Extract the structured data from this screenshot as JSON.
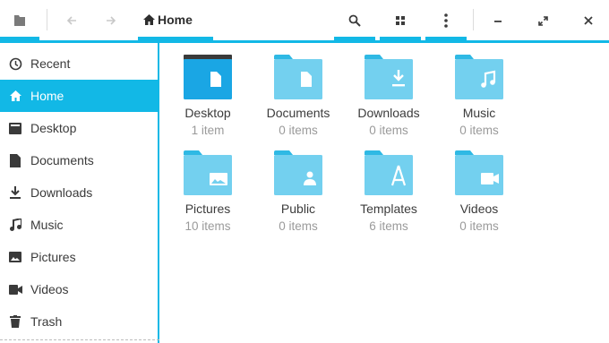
{
  "colors": {
    "accent": "#12b8e6",
    "folder": "#73d0ef",
    "folder_tab": "#2fb9e4",
    "desktop_folder": "#1aa6e4",
    "desktop_tab": "#3a3a3a"
  },
  "header": {
    "breadcrumb": {
      "icon": "home-icon",
      "label": "Home"
    },
    "buttons": [
      "file-manager-icon",
      "back-arrow-icon",
      "forward-arrow-icon",
      "search-icon",
      "grid-view-icon",
      "more-vertical-icon",
      "minimize-icon",
      "maximize-icon",
      "close-icon"
    ]
  },
  "sidebar": {
    "items": [
      {
        "label": "Recent",
        "icon": "clock-icon"
      },
      {
        "label": "Home",
        "icon": "home-icon",
        "active": true
      },
      {
        "label": "Desktop",
        "icon": "desktop-icon"
      },
      {
        "label": "Documents",
        "icon": "document-icon"
      },
      {
        "label": "Downloads",
        "icon": "download-icon"
      },
      {
        "label": "Music",
        "icon": "music-icon"
      },
      {
        "label": "Pictures",
        "icon": "picture-icon"
      },
      {
        "label": "Videos",
        "icon": "video-icon"
      },
      {
        "label": "Trash",
        "icon": "trash-icon"
      }
    ]
  },
  "folders": [
    {
      "name": "Desktop",
      "count": "1 item"
    },
    {
      "name": "Documents",
      "count": "0 items"
    },
    {
      "name": "Downloads",
      "count": "0 items"
    },
    {
      "name": "Music",
      "count": "0 items"
    },
    {
      "name": "Pictures",
      "count": "10 items"
    },
    {
      "name": "Public",
      "count": "0 items"
    },
    {
      "name": "Templates",
      "count": "6 items"
    },
    {
      "name": "Videos",
      "count": "0 items"
    }
  ]
}
